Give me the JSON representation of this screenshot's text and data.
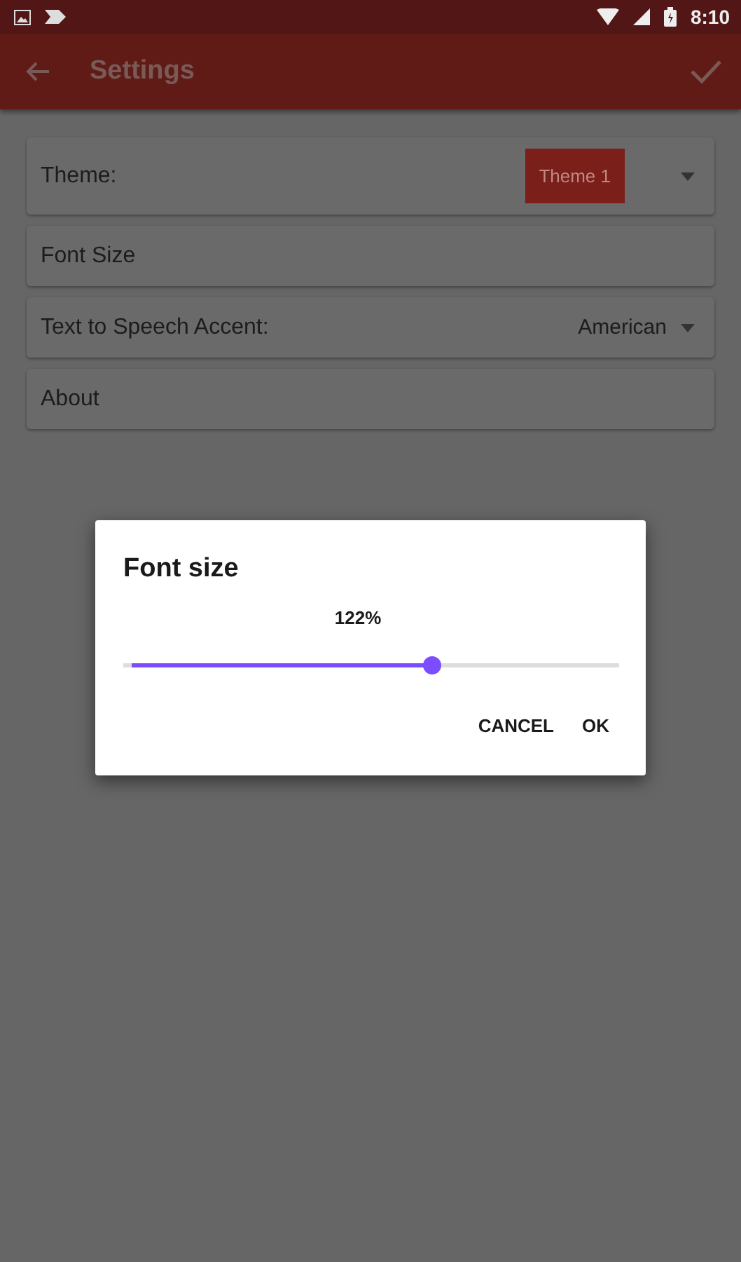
{
  "status_bar": {
    "time": "8:10"
  },
  "app_bar": {
    "title": "Settings"
  },
  "settings": [
    {
      "kind": "swatch",
      "label": "Theme:",
      "value": "Theme 1"
    },
    {
      "kind": "plain",
      "label": "Font Size"
    },
    {
      "kind": "dropdown",
      "label": "Text to Speech Accent:",
      "value": "American"
    },
    {
      "kind": "plain",
      "label": "About"
    }
  ],
  "dialog": {
    "title": "Font size",
    "reading": "122%",
    "level": 0.626,
    "buttons": [
      "CANCEL",
      "OK"
    ]
  }
}
